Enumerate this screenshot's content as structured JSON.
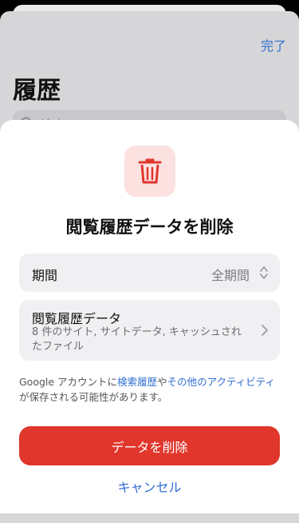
{
  "background": {
    "done_label": "完了",
    "title": "履歴",
    "search_placeholder": "検索"
  },
  "sheet": {
    "title": "閲覧履歴データを削除",
    "period_label": "期間",
    "period_value": "全期間",
    "browsing_label": "閲覧履歴データ",
    "browsing_desc": "8 件のサイト, サイトデータ, キャッシュされたファイル",
    "info": {
      "part1": "Google アカウントに",
      "link1": "検索履歴",
      "part2": "や",
      "link2": "その他のアクティビティ",
      "part3": "が保存される可能性があります。"
    },
    "delete_label": "データを削除",
    "cancel_label": "キャンセル"
  },
  "colors": {
    "accent": "#2f6fd1",
    "danger": "#e0362c",
    "icon_bg": "#fbe1e0"
  },
  "icons": {
    "trash": "trash-icon",
    "search": "search-icon",
    "updown": "chevron-updown-icon",
    "right": "chevron-right-icon"
  }
}
